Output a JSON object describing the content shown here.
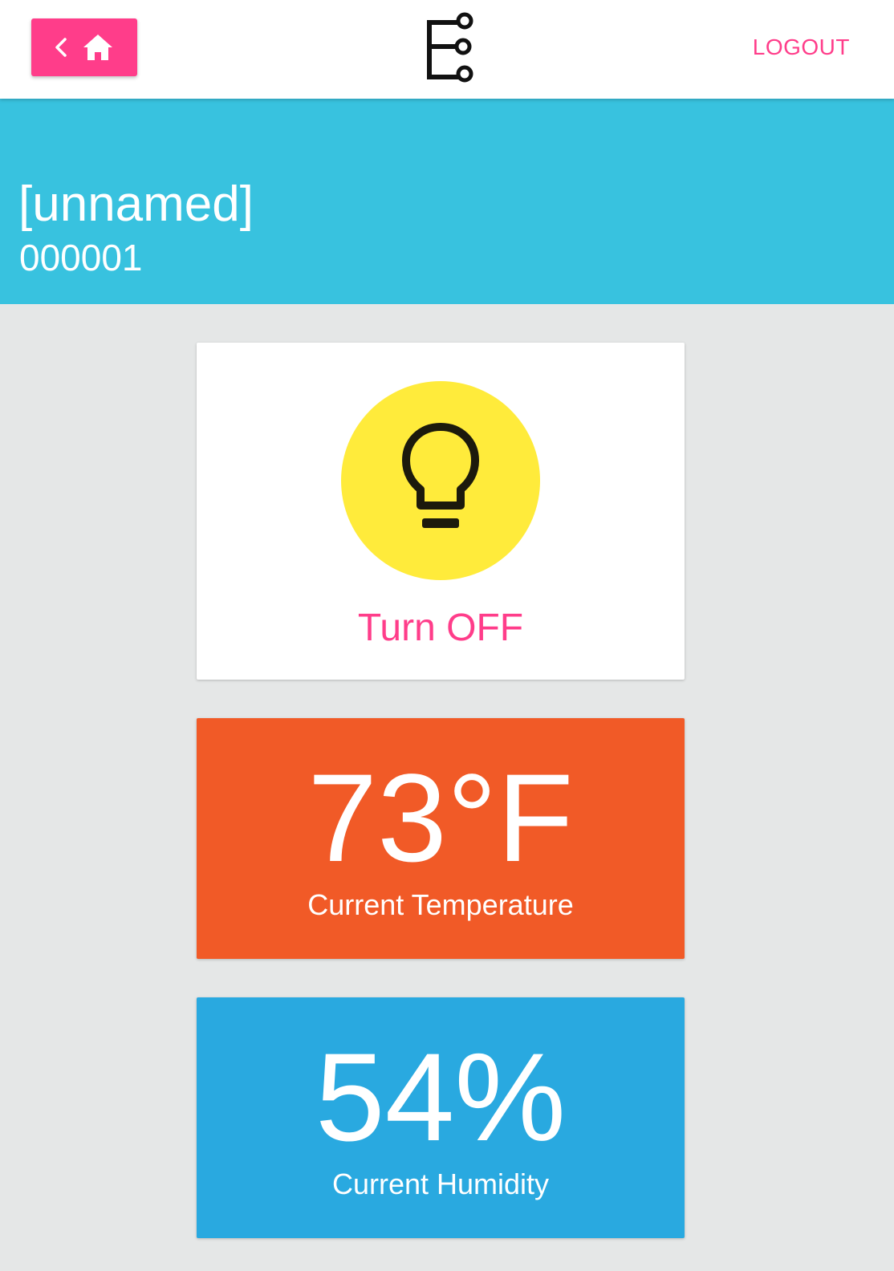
{
  "topbar": {
    "home_button": {
      "icons": [
        "chevron-left-icon",
        "home-icon"
      ]
    },
    "logo": "app-logo-icon",
    "logout_label": "LOGOUT"
  },
  "device": {
    "name": "[unnamed]",
    "id": "000001"
  },
  "light_card": {
    "icon": "lightbulb-icon",
    "action_label": "Turn OFF"
  },
  "temperature_card": {
    "value": "73°F",
    "label": "Current Temperature"
  },
  "humidity_card": {
    "value": "54%",
    "label": "Current Humidity"
  },
  "colors": {
    "accent": "#ff3d8a",
    "header": "#38c2df",
    "background": "#e5e7e7",
    "bulb_circle": "#ffeb3b",
    "temperature": "#f15a27",
    "humidity": "#29a9e0"
  }
}
